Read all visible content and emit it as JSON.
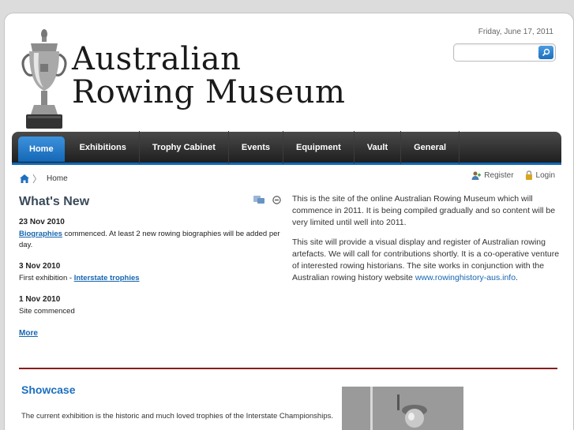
{
  "header": {
    "date": "Friday, June 17, 2011",
    "title_line1": "Australian",
    "title_line2": "Rowing Museum",
    "search_placeholder": ""
  },
  "nav": {
    "items": [
      "Home",
      "Exhibitions",
      "Trophy Cabinet",
      "Events",
      "Equipment",
      "Vault",
      "General"
    ],
    "active": "Home"
  },
  "breadcrumb": {
    "label": "Home"
  },
  "user": {
    "register": "Register",
    "login": "Login"
  },
  "whats_new": {
    "title": "What's New",
    "items": [
      {
        "date": "23 Nov 2010",
        "link": "Biographies",
        "text": " commenced. At least 2 new rowing biographies will be added per day."
      },
      {
        "date": "3 Nov 2010",
        "prefix": "First exhibition - ",
        "link": "Interstate trophies"
      },
      {
        "date": "1 Nov 2010",
        "text": "Site commenced"
      }
    ],
    "more": "More"
  },
  "intro": {
    "p1": "This is the site of the online Australian Rowing Museum which will commence in 2011. It is being compiled gradually and so content will be very limited until well into 2011.",
    "p2": " This site will provide a visual display and register of Australian rowing artefacts. We will call for contributions shortly. It is a co-operative venture of interested rowing historians. The site works in conjunction with the Australian rowing history website ",
    "link": "www.rowinghistory-aus.info",
    "after_link": "."
  },
  "showcase": {
    "title": "Showcase",
    "text": "The current exhibition is the historic and much loved trophies of the Interstate Championships."
  },
  "colors": {
    "accent": "#1d6fc0",
    "nav_bg": "#2a2a2a",
    "divider": "#8a1c1c"
  }
}
